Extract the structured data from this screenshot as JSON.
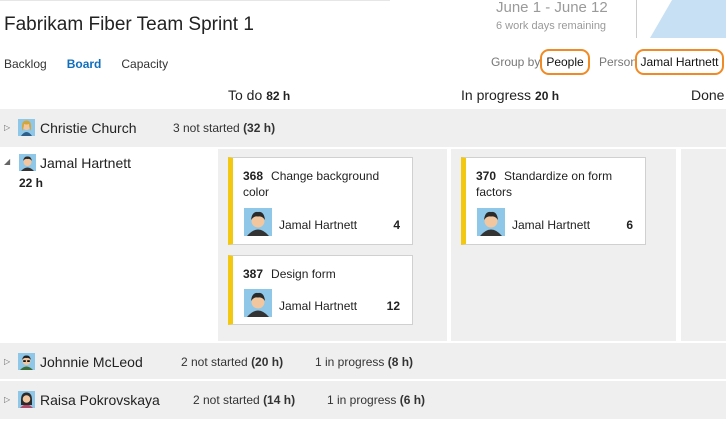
{
  "header": {
    "title": "Fabrikam Fiber Team Sprint 1",
    "date_range": "June 1 - June 12",
    "days_remaining": "6 work days remaining"
  },
  "nav": {
    "tabs": [
      {
        "label": "Backlog",
        "active": false
      },
      {
        "label": "Board",
        "active": true
      },
      {
        "label": "Capacity",
        "active": false
      }
    ]
  },
  "filters": {
    "group_by_label": "Group by",
    "group_by_value": "People",
    "person_label": "Person",
    "person_value": "Jamal Hartnett",
    "highlight_color": "#f08a24"
  },
  "columns": [
    {
      "name": "To do",
      "hours": "82 h"
    },
    {
      "name": "In progress",
      "hours": "20 h"
    },
    {
      "name": "Done",
      "hours": ""
    }
  ],
  "lanes": [
    {
      "person": "Christie Church",
      "summary": [
        {
          "text": "3 not started",
          "hours": "(32 h)"
        }
      ]
    },
    {
      "person": "Jamal Hartnett",
      "hours": "22 h",
      "todo_cards": [
        {
          "id": "368",
          "title": "Change background color",
          "assignee": "Jamal Hartnett",
          "remaining": "4"
        },
        {
          "id": "387",
          "title": "Design form",
          "assignee": "Jamal Hartnett",
          "remaining": "12"
        }
      ],
      "inprogress_cards": [
        {
          "id": "370",
          "title": "Standardize on form factors",
          "assignee": "Jamal Hartnett",
          "remaining": "6"
        }
      ]
    },
    {
      "person": "Johnnie McLeod",
      "summary": [
        {
          "text": "2 not started",
          "hours": "(20 h)"
        },
        {
          "text": "1 in progress",
          "hours": "(8 h)"
        }
      ]
    },
    {
      "person": "Raisa Pokrovskaya",
      "summary": [
        {
          "text": "2 not started",
          "hours": "(14 h)"
        },
        {
          "text": "1 in progress",
          "hours": "(6 h)"
        }
      ]
    }
  ],
  "colors": {
    "card_accent": "#f2c811",
    "active_tab": "#106ebe",
    "lane_background": "#efefef"
  },
  "icons": {
    "expand": "triangle-right-icon",
    "collapse": "triangle-down-icon"
  }
}
